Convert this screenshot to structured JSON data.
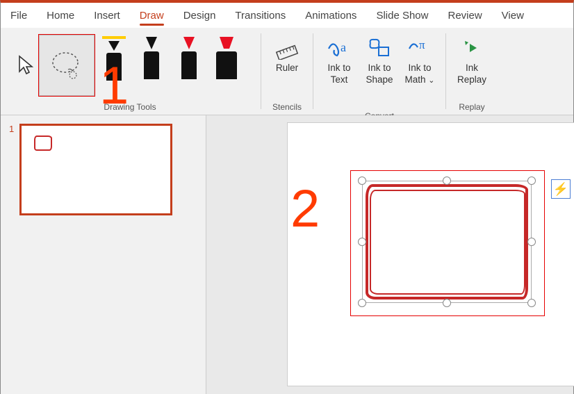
{
  "tabs": {
    "file": "File",
    "home": "Home",
    "insert": "Insert",
    "draw": "Draw",
    "design": "Design",
    "transitions": "Transitions",
    "animations": "Animations",
    "slideshow": "Slide Show",
    "review": "Review",
    "view": "View"
  },
  "ribbon": {
    "groups": {
      "drawing_tools": "Drawing Tools",
      "stencils": "Stencils",
      "convert": "Convert",
      "replay": "Replay"
    },
    "ruler": "Ruler",
    "ink_to_text_1": "Ink to",
    "ink_to_text_2": "Text",
    "ink_to_shape_1": "Ink to",
    "ink_to_shape_2": "Shape",
    "ink_to_math_1": "Ink to",
    "ink_to_math_2": "Math",
    "ink_replay_1": "Ink",
    "ink_replay_2": "Replay",
    "pen_colors": {
      "pen1": "#ffcc00",
      "pen2": "#111111",
      "pen3": "#e81123",
      "pen4": "#e81123"
    }
  },
  "annotations": {
    "one": "1",
    "two": "2"
  },
  "panel": {
    "slide_number": "1"
  },
  "icons": {
    "bolt": "⚡"
  }
}
